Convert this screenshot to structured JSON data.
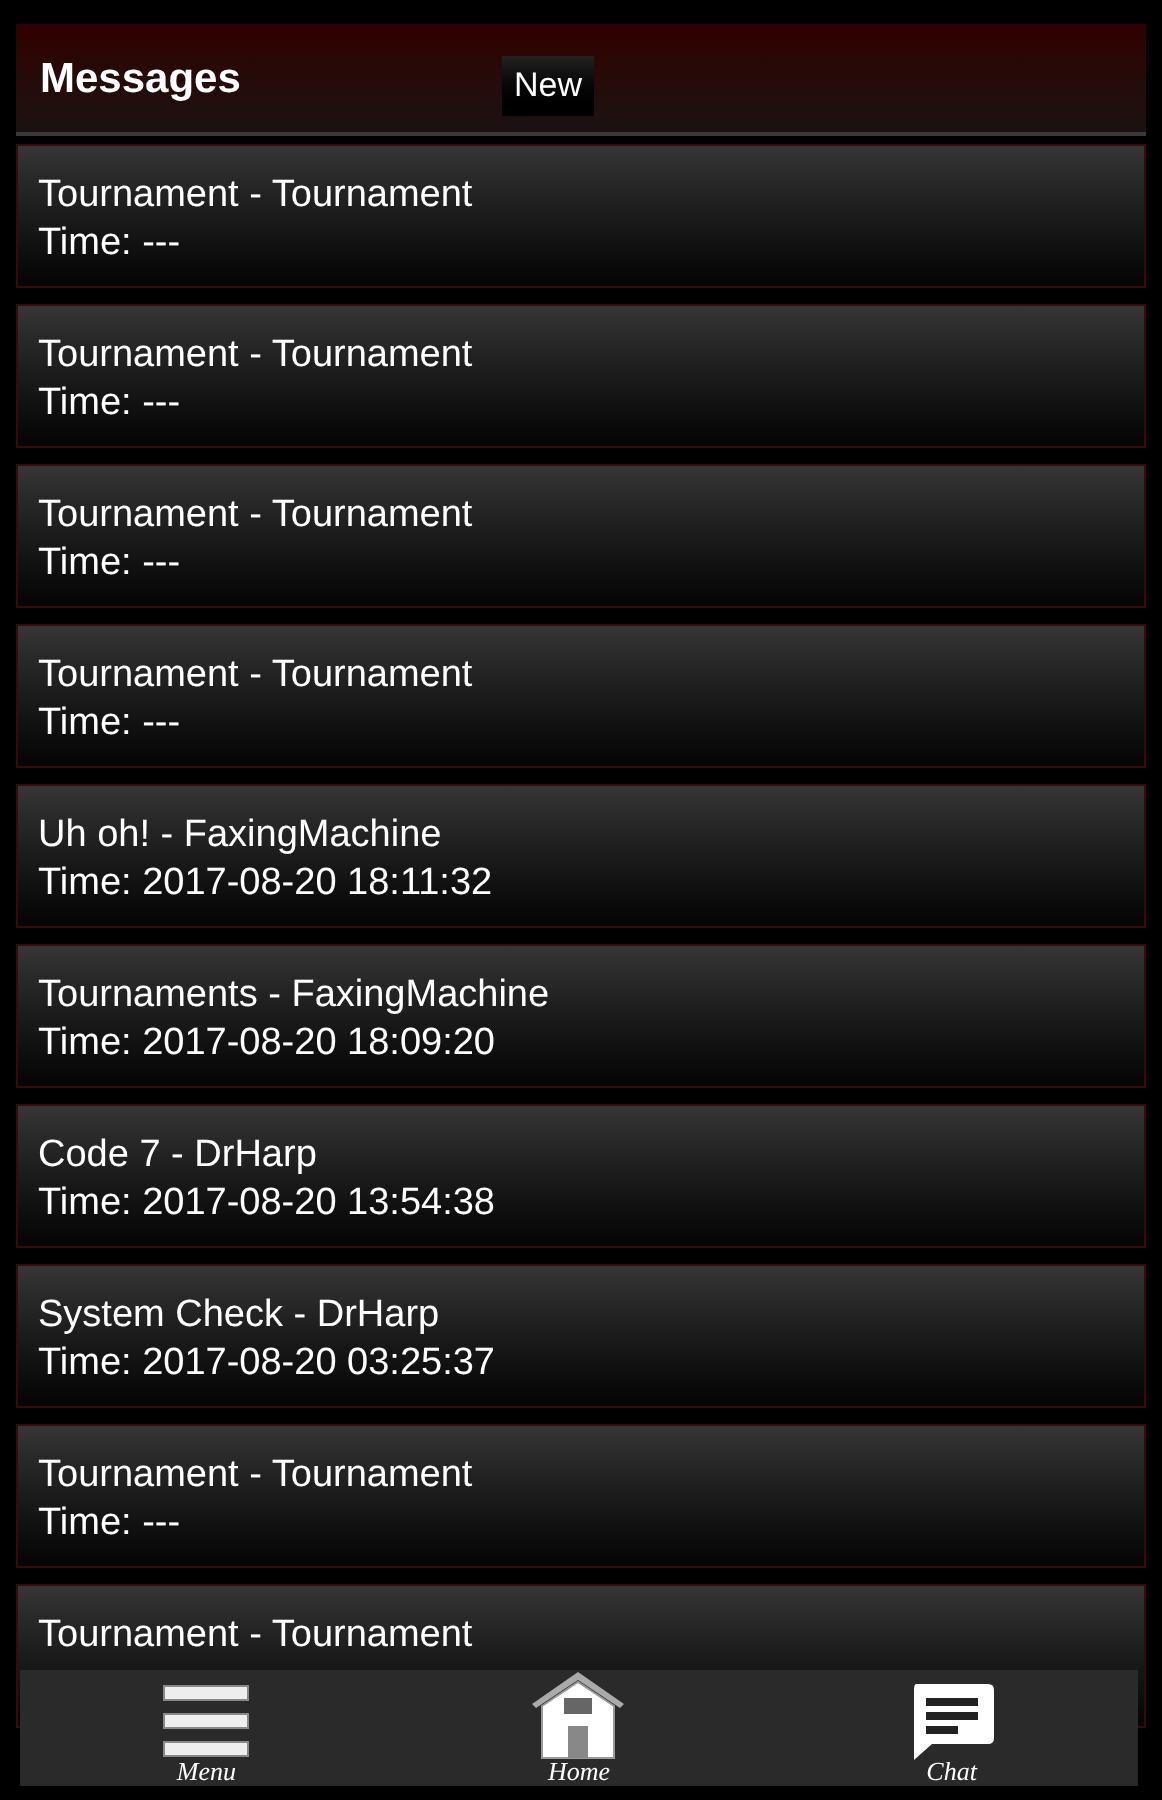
{
  "header": {
    "title": "Messages",
    "new_button": "New"
  },
  "messages": [
    {
      "title": "Tournament - Tournament",
      "time": "Time: ---"
    },
    {
      "title": "Tournament - Tournament",
      "time": "Time: ---"
    },
    {
      "title": "Tournament - Tournament",
      "time": "Time: ---"
    },
    {
      "title": "Tournament - Tournament",
      "time": "Time: ---"
    },
    {
      "title": "Uh oh! - FaxingMachine",
      "time": "Time: 2017-08-20 18:11:32"
    },
    {
      "title": "Tournaments - FaxingMachine",
      "time": "Time: 2017-08-20 18:09:20"
    },
    {
      "title": "Code 7 - DrHarp",
      "time": "Time: 2017-08-20 13:54:38"
    },
    {
      "title": "System Check - DrHarp",
      "time": "Time: 2017-08-20 03:25:37"
    },
    {
      "title": "Tournament - Tournament",
      "time": "Time: ---"
    },
    {
      "title": "Tournament - Tournament"
    }
  ],
  "nav": [
    {
      "kind": "menu",
      "label": "Menu"
    },
    {
      "kind": "home",
      "label": "Home"
    },
    {
      "kind": "chat",
      "label": "Chat"
    }
  ]
}
